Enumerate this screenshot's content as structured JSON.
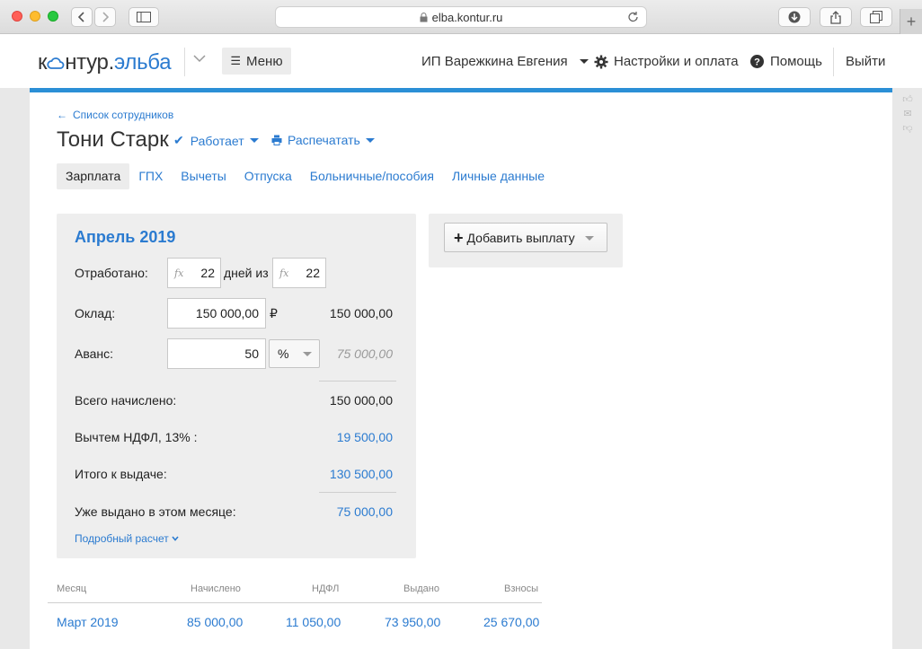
{
  "browser": {
    "url": "elba.kontur.ru"
  },
  "header": {
    "logo_part1": "к",
    "logo_part2": "нтур.",
    "logo_part3": "эльба",
    "menu_label": "Меню",
    "account_label": "ИП Варежкина Евгения",
    "settings_label": "Настройки и оплата",
    "help_label": "Помощь",
    "logout_label": "Выйти"
  },
  "page": {
    "back_link": "Список сотрудников",
    "employee_name": "Тони Старк",
    "status": "Работает",
    "print": "Распечатать"
  },
  "tabs": [
    {
      "label": "Зарплата",
      "active": true
    },
    {
      "label": "ГПХ",
      "active": false
    },
    {
      "label": "Вычеты",
      "active": false
    },
    {
      "label": "Отпуска",
      "active": false
    },
    {
      "label": "Больничные/пособия",
      "active": false
    },
    {
      "label": "Личные данные",
      "active": false
    }
  ],
  "month": {
    "title": "Апрель 2019",
    "worked_label": "Отработано:",
    "worked_days": "22",
    "days_of_label": "дней из",
    "total_days": "22",
    "salary_label": "Оклад:",
    "salary_value": "150 000,00",
    "currency": "₽",
    "salary_amount": "150 000,00",
    "advance_label": "Аванс:",
    "advance_value": "50",
    "advance_unit": "%",
    "advance_amount": "75 000,00",
    "accrued_label": "Всего начислено:",
    "accrued_amount": "150 000,00",
    "ndfl_label": "Вычтем НДФЛ, 13% :",
    "ndfl_amount": "19 500,00",
    "payout_label": "Итого к выдаче:",
    "payout_amount": "130 500,00",
    "paid_label": "Уже выдано в этом месяце:",
    "paid_amount": "75 000,00",
    "detail_link": "Подробный расчет"
  },
  "add_payment": {
    "label": "Добавить выплату"
  },
  "history": {
    "columns": [
      "Месяц",
      "Начислено",
      "НДФЛ",
      "Выдано",
      "Взносы"
    ],
    "rows": [
      [
        "Март 2019",
        "85 000,00",
        "11 050,00",
        "73 950,00",
        "25 670,00"
      ]
    ]
  },
  "colors": {
    "accent": "#2b7bd0",
    "top_border": "#2b8fd6",
    "panel_bg": "#eeeeee"
  }
}
